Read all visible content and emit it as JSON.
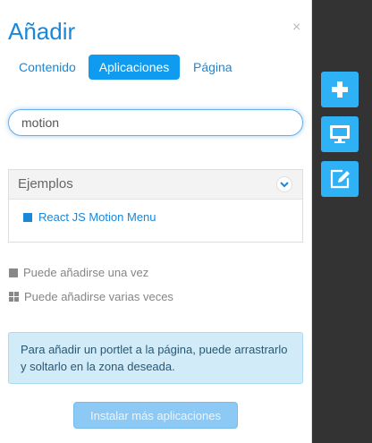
{
  "panel": {
    "title": "Añadir",
    "close_label": "×",
    "tabs": [
      {
        "label": "Contenido",
        "active": false
      },
      {
        "label": "Aplicaciones",
        "active": true
      },
      {
        "label": "Página",
        "active": false
      }
    ],
    "search": {
      "value": "motion",
      "placeholder": ""
    },
    "category": {
      "title": "Ejemplos",
      "items": [
        {
          "label": "React JS Motion Menu"
        }
      ]
    },
    "legend": {
      "once": "Puede añadirse una vez",
      "multiple": "Puede añadirse varias veces"
    },
    "info": "Para añadir un portlet a la página, puede arrastrarlo y soltarlo en la zona deseada.",
    "install_button": "Instalar más aplicaciones"
  },
  "sidebar": {
    "buttons": [
      {
        "icon": "plus-icon"
      },
      {
        "icon": "monitor-icon"
      },
      {
        "icon": "edit-icon"
      }
    ]
  },
  "colors": {
    "accent": "#1a87d9",
    "active_tab": "#0f9cf0",
    "side_button": "#2fb2f5",
    "dark_bar": "#333333",
    "info_bg": "#d1ecf8"
  }
}
